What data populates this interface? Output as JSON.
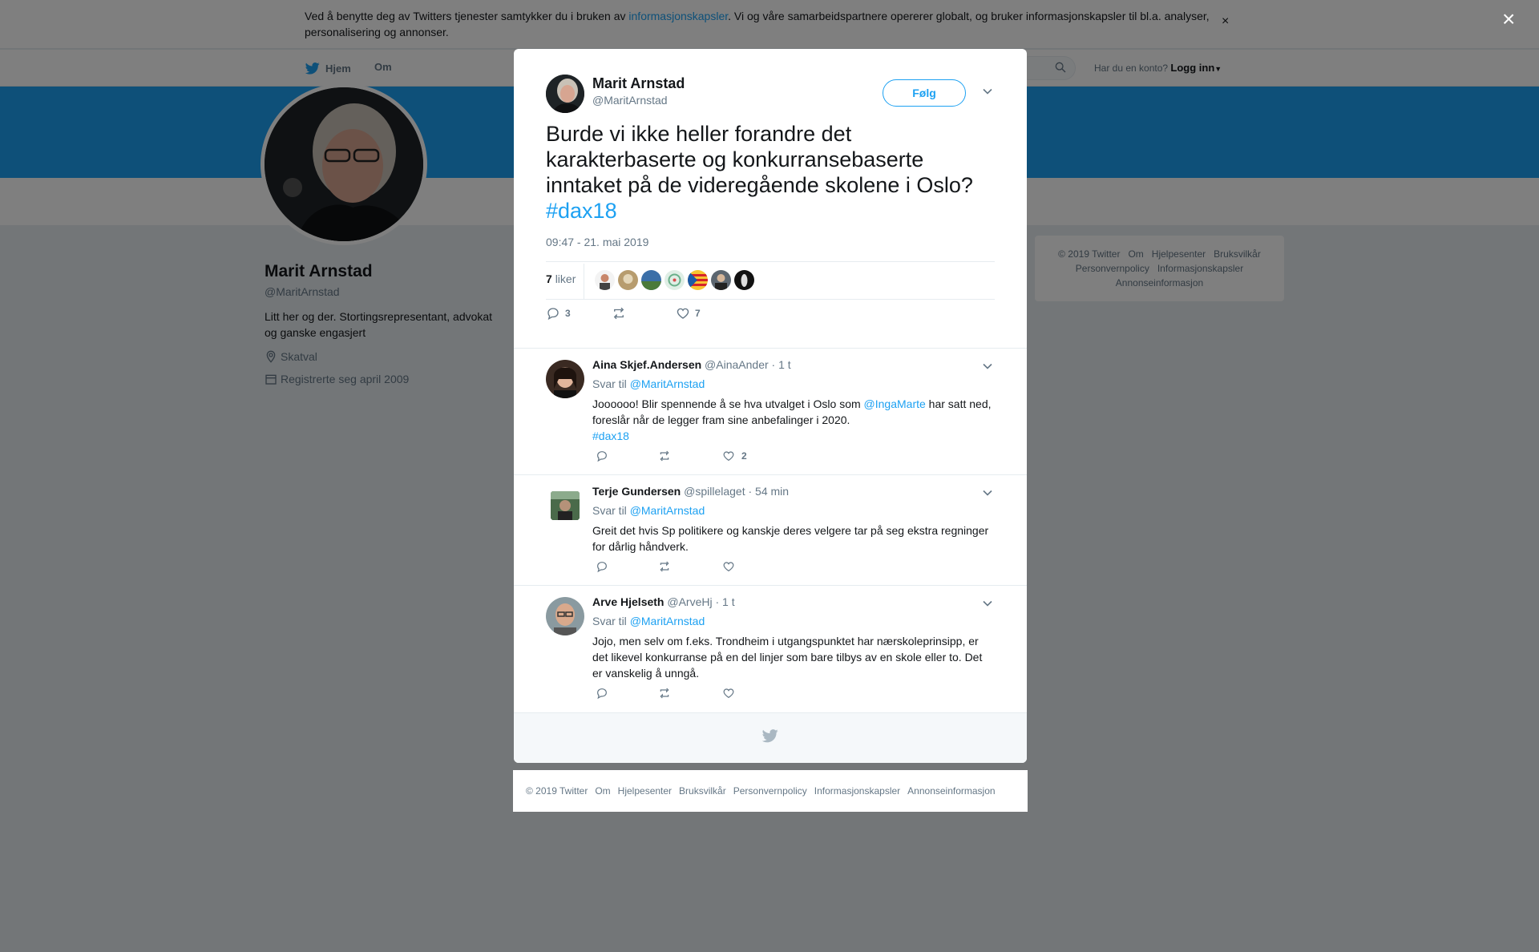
{
  "cookie": {
    "text_before": "Ved å benytte deg av Twitters tjenester samtykker du i bruken av ",
    "link": "informasjonskapsler",
    "text_after": ". Vi og våre samarbeidspartnere opererer globalt, og bruker informasjonskapsler til bl.a. analyser, personalisering og annonser.",
    "close": "×"
  },
  "nav": {
    "home": "Hjem",
    "about": "Om",
    "account_prompt": "Har du en konto?",
    "login": "Logg inn"
  },
  "profile": {
    "name": "Marit Arnstad",
    "handle": "@MaritArnstad",
    "bio": "Litt her og der. Stortingsrepresentant, advokat og ganske engasjert",
    "location": "Skatval",
    "joined": "Registrerte seg april 2009"
  },
  "side_footer": {
    "items": [
      "© 2019 Twitter",
      "Om",
      "Hjelpesenter",
      "Bruksvilkår",
      "Personvernpolicy",
      "Informasjonskapsler",
      "Annonseinformasjon"
    ]
  },
  "overlay": {
    "close": "×"
  },
  "tweet": {
    "name": "Marit Arnstad",
    "handle": "@MaritArnstad",
    "follow": "Følg",
    "text": "Burde vi ikke heller forandre det karakterbaserte og konkurransebaserte inntaket på de videregående skolene i Oslo?",
    "hashtag": "#dax18",
    "time": "09:47 - 21. mai 2019",
    "likes_count": "7",
    "likes_label": "liker",
    "actions": {
      "replies": "3",
      "retweets": "",
      "likes": "7"
    }
  },
  "replies": [
    {
      "name": "Aina Skjef.Andersen",
      "handle": "@AinaAnder",
      "time": "· 1 t",
      "reply_to_label": "Svar til",
      "reply_to": "@MaritArnstad",
      "text_1": "Joooooo! Blir spennende å se hva utvalget i Oslo som ",
      "mention": "@IngaMarte",
      "text_2": " har satt ned, foreslår når de legger fram sine anbefalinger i 2020.",
      "hashtag": "#dax18",
      "replies": "",
      "retweets": "",
      "likes": "2"
    },
    {
      "name": "Terje Gundersen",
      "handle": "@spillelaget",
      "time": "· 54 min",
      "reply_to_label": "Svar til",
      "reply_to": "@MaritArnstad",
      "text": "Greit det hvis Sp politikere og kanskje deres velgere tar på seg ekstra regninger for dårlig håndverk.",
      "replies": "",
      "retweets": "",
      "likes": ""
    },
    {
      "name": "Arve Hjelseth",
      "handle": "@ArveHj",
      "time": "· 1 t",
      "reply_to_label": "Svar til",
      "reply_to": "@MaritArnstad",
      "text": "Jojo, men selv om f.eks. Trondheim i utgangspunktet har nærskoleprinsipp, er det likevel konkurranse på en del linjer som bare tilbys av en skole eller to. Det er vanskelig å unngå.",
      "replies": "",
      "retweets": "",
      "likes": ""
    }
  ],
  "page_footer": {
    "items": [
      "© 2019 Twitter",
      "Om",
      "Hjelpesenter",
      "Bruksvilkår",
      "Personvernpolicy",
      "Informasjonskapsler",
      "Annonseinformasjon"
    ]
  },
  "colors": {
    "brand": "#1da1f2",
    "text": "#14171a",
    "muted": "#657786",
    "overlay": "rgba(0,0,0,0.5)"
  },
  "icons": [
    "twitter-bird-icon",
    "search-icon",
    "caret-down-icon",
    "location-icon",
    "calendar-icon",
    "reply-icon",
    "retweet-icon",
    "like-icon",
    "close-icon"
  ]
}
